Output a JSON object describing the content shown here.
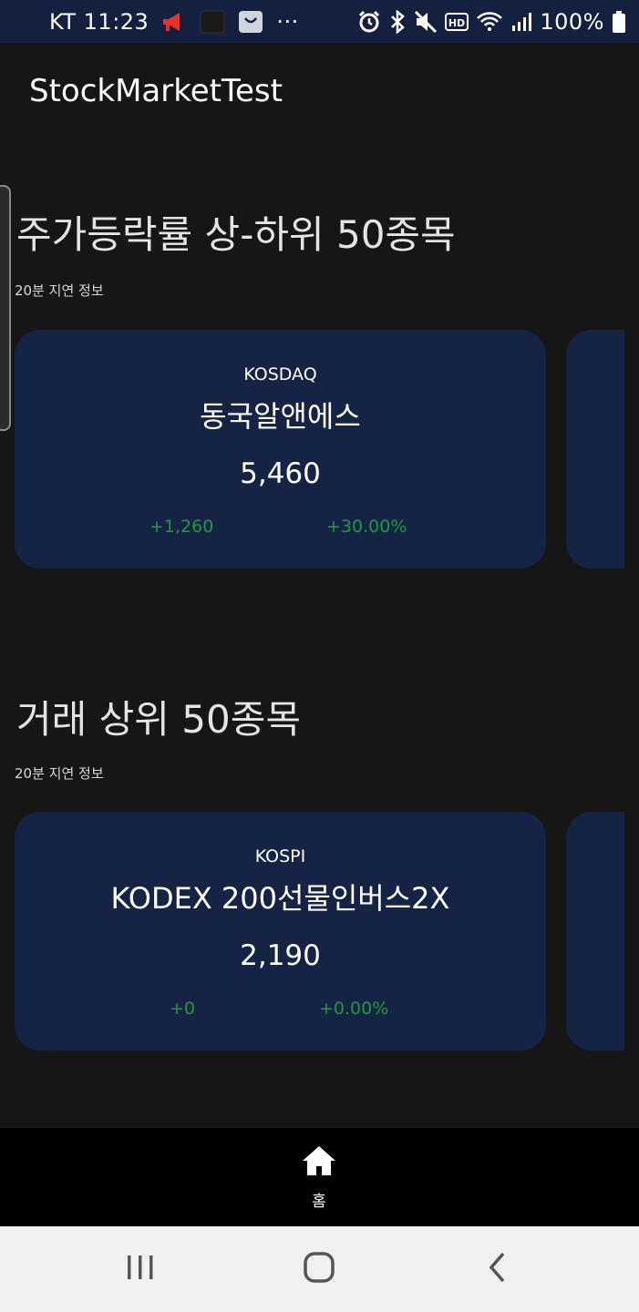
{
  "status_bar": {
    "carrier_time": "KT 11:23",
    "more": "···",
    "battery": "100%"
  },
  "app": {
    "title": "StockMarketTest"
  },
  "sections": [
    {
      "title": "주가등락률 상-하위 50종목",
      "subtitle": "20분 지연 정보",
      "card": {
        "market": "KOSDAQ",
        "name": "동국알앤에스",
        "price": "5,460",
        "change": "+1,260",
        "change_pct": "+30.00%"
      }
    },
    {
      "title": "거래 상위 50종목",
      "subtitle": "20분 지연 정보",
      "card": {
        "market": "KOSPI",
        "name": "KODEX 200선물인버스2X",
        "price": "2,190",
        "change": "+0",
        "change_pct": "+0.00%"
      }
    }
  ],
  "bottom_nav": {
    "home_label": "홈",
    "home_icon": "home-icon"
  },
  "system_nav": {
    "recents_icon": "recents-icon",
    "home_icon": "system-home-icon",
    "back_icon": "back-icon"
  },
  "colors": {
    "background": "#161616",
    "status_bar": "#132040",
    "card": "#152345",
    "positive": "#1f9a3c"
  }
}
